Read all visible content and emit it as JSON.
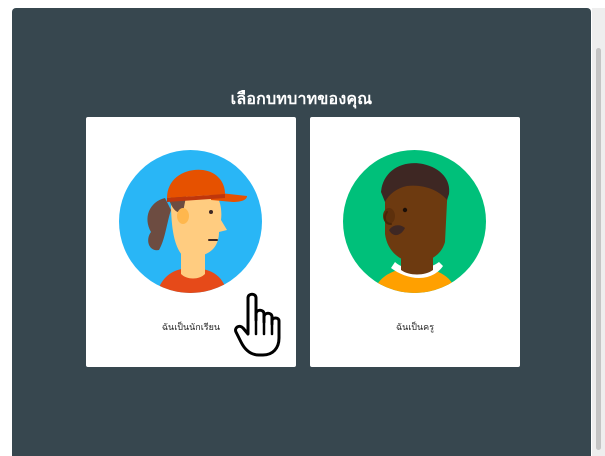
{
  "dialog": {
    "title": "เลือกบทบาทของคุณ",
    "cards": [
      {
        "label": "ฉันเป็นนักเรียน",
        "icon": "student-avatar-icon"
      },
      {
        "label": "ฉันเป็นครู",
        "icon": "teacher-avatar-icon"
      }
    ]
  },
  "colors": {
    "dialog_bg": "#37474f",
    "student_circle": "#29b6f6",
    "teacher_circle": "#00c07a",
    "cap": "#e65100",
    "accent_shirt": "#ffa000"
  },
  "cursor": {
    "icon": "hand-pointer-icon"
  }
}
